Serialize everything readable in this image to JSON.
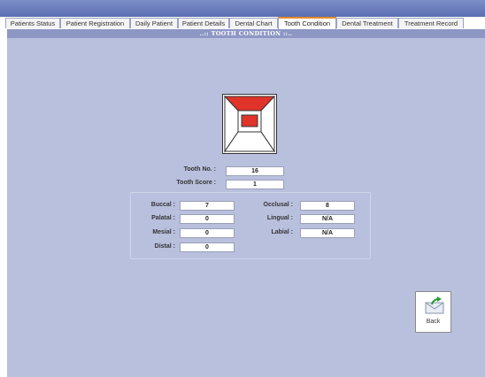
{
  "tabs": [
    {
      "label": "Patients Status"
    },
    {
      "label": "Patient Registration"
    },
    {
      "label": "Daily Patient"
    },
    {
      "label": "Patient Details"
    },
    {
      "label": "Dental Chart"
    },
    {
      "label": "Tooth Condition"
    },
    {
      "label": "Dental Treatment"
    },
    {
      "label": "Treatment Record"
    }
  ],
  "active_tab": "Tooth Condition",
  "title": "..:: TOOTH CONDITION ::..",
  "tooth": {
    "no_label": "Tooth No. :",
    "no_value": "16",
    "score_label": "Tooth Score :",
    "score_value": "1",
    "highlight_color": "#e0342a"
  },
  "surfaces": {
    "buccal_label": "Buccal :",
    "buccal_value": "7",
    "occlusal_label": "Occlusal :",
    "occlusal_value": "8",
    "palatal_label": "Palatal :",
    "palatal_value": "0",
    "lingual_label": "Lingual :",
    "lingual_value": "N/A",
    "mesial_label": "Mesial :",
    "mesial_value": "0",
    "labial_label": "Labial :",
    "labial_value": "N/A",
    "distal_label": "Distal :",
    "distal_value": "0"
  },
  "back_button": {
    "label": "Back",
    "icon": "back-envelope-arrow-icon"
  }
}
